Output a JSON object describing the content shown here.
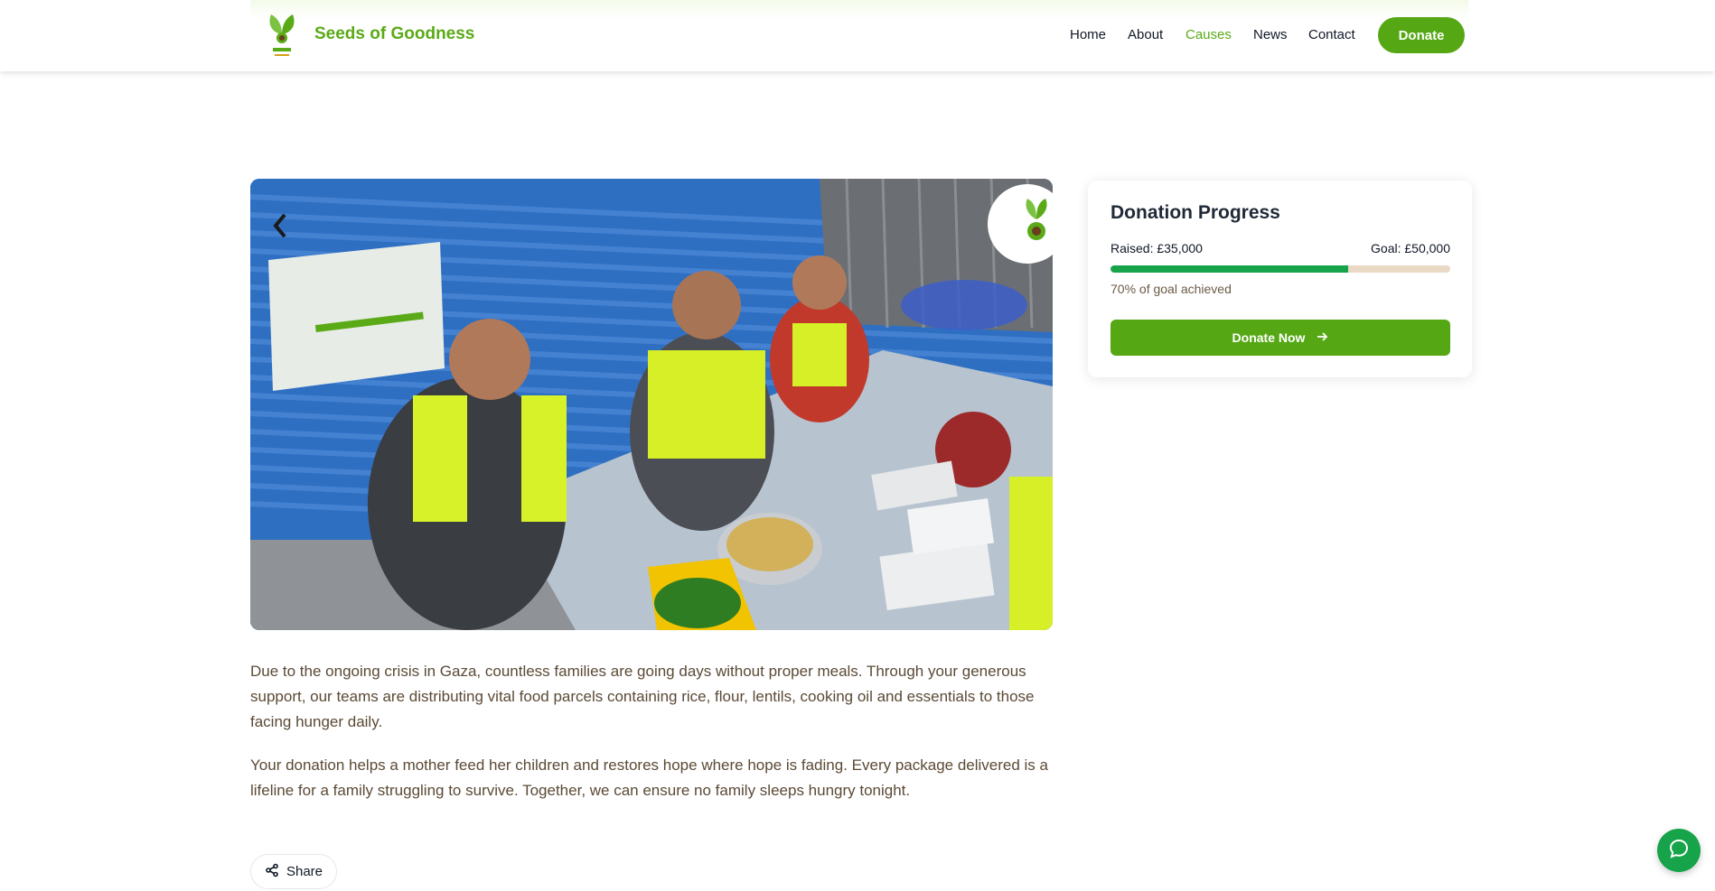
{
  "header": {
    "brand": "Seeds of Goodness",
    "nav": [
      {
        "label": "Home",
        "active": false
      },
      {
        "label": "About",
        "active": false
      },
      {
        "label": "Causes",
        "active": true
      },
      {
        "label": "News",
        "active": false
      },
      {
        "label": "Contact",
        "active": false
      }
    ],
    "donate_label": "Donate"
  },
  "content": {
    "paragraphs": [
      "Due to the ongoing crisis in Gaza, countless families are going days without proper meals. Through your generous support, our teams are distributing vital food parcels containing rice, flour, lentils, cooking oil and essentials to those facing hunger daily.",
      "Your donation helps a mother feed her children and restores hope where hope is fading. Every package delivered is a lifeline for a family struggling to survive. Together, we can ensure no family sleeps hungry tonight."
    ],
    "share_label": "Share"
  },
  "donation": {
    "title": "Donation Progress",
    "raised_label": "Raised: £35,000",
    "goal_label": "Goal: £50,000",
    "progress_percent": 70,
    "achieved_label": "70% of goal achieved",
    "button_label": "Donate Now"
  },
  "colors": {
    "brand_green": "#55a814",
    "progress_green": "#17a34a",
    "progress_track": "#ead9c4",
    "text_brown": "#5b4a36"
  },
  "icons": {
    "share": "share-icon",
    "arrow": "arrow-right-icon",
    "chat": "chat-bubble-icon",
    "logo": "sprout-logo-icon"
  }
}
